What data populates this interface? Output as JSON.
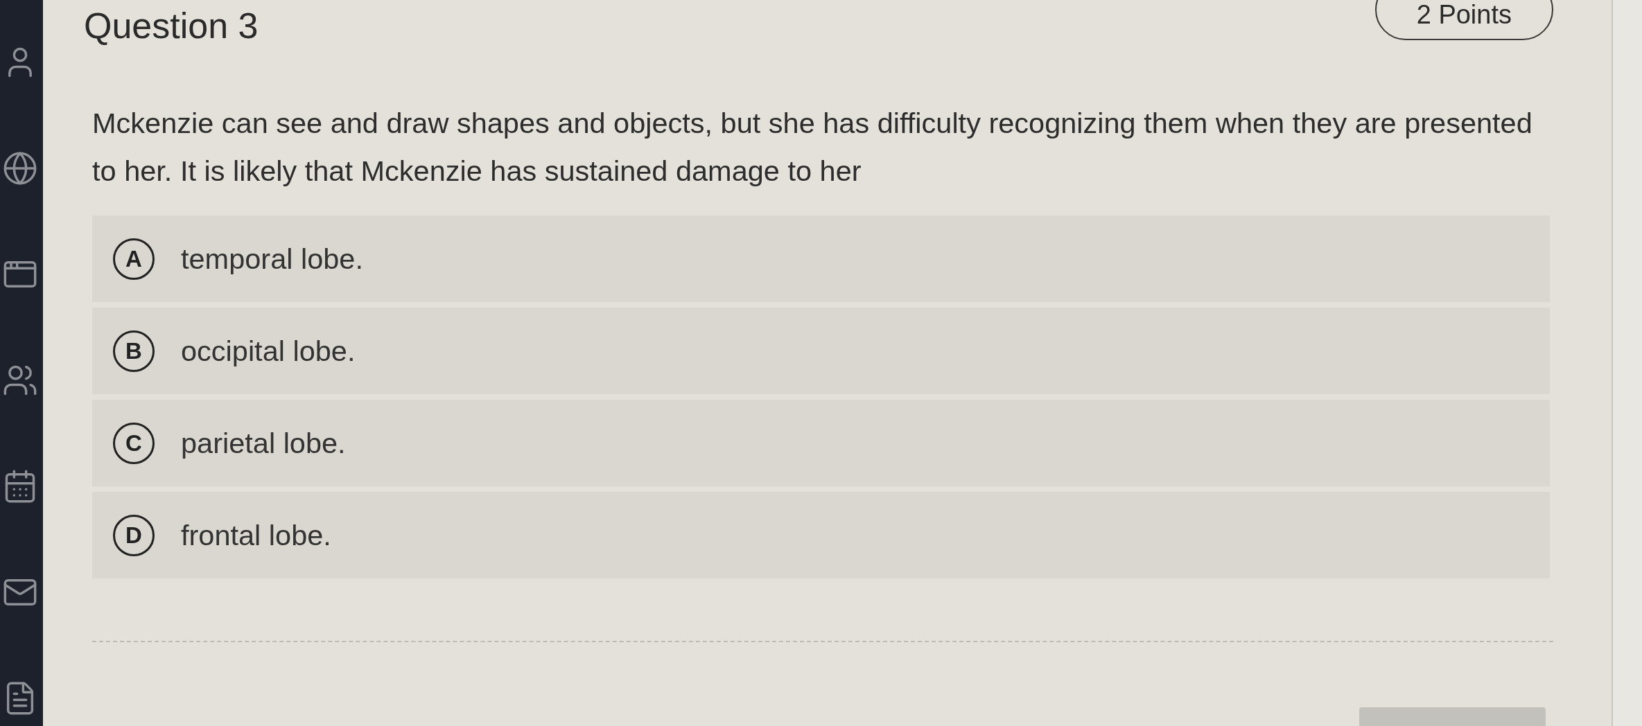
{
  "question": {
    "title": "Question 3",
    "points": "2 Points",
    "prompt": "Mckenzie can see and draw shapes and objects, but she has difficulty recognizing them when they are presented to her. It is likely that Mckenzie has sustained damage to her"
  },
  "options": [
    {
      "letter": "A",
      "text": "temporal lobe.",
      "selected": false
    },
    {
      "letter": "B",
      "text": "occipital lobe.",
      "selected": false
    },
    {
      "letter": "C",
      "text": "parietal lobe.",
      "selected": false
    },
    {
      "letter": "D",
      "text": "frontal lobe.",
      "selected": false
    }
  ]
}
